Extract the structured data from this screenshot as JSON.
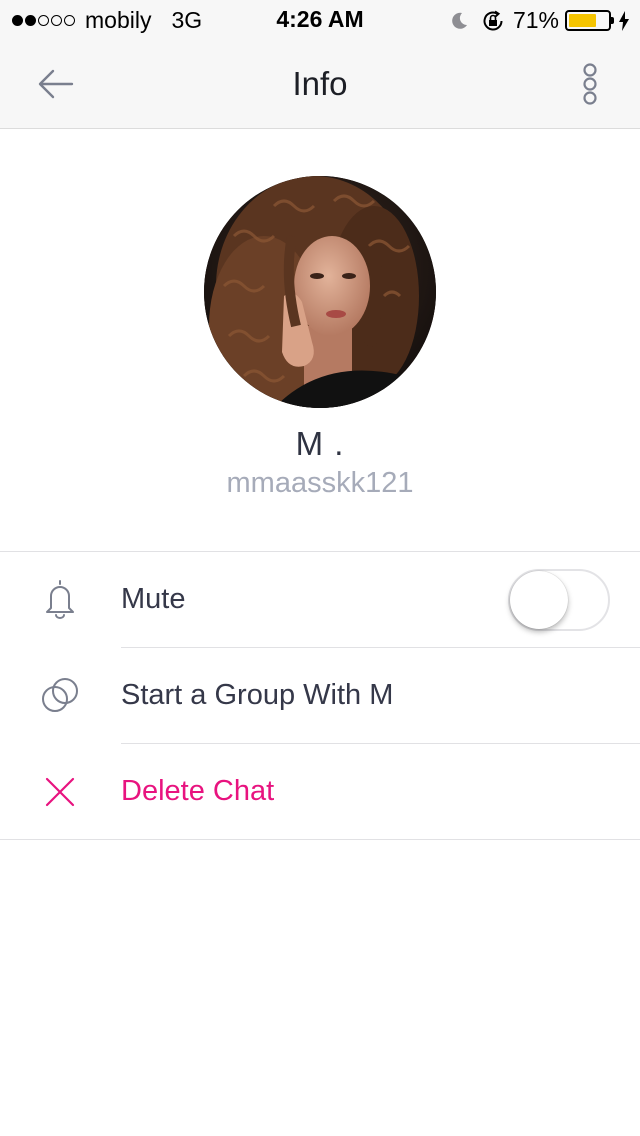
{
  "status_bar": {
    "carrier": "mobily",
    "network": "3G",
    "time": "4:26 AM",
    "battery": "71%",
    "battery_level": 0.71,
    "signal_bars": 2,
    "signal_total": 5,
    "battery_color": "#f5c400"
  },
  "nav": {
    "title": "Info",
    "back_icon": "arrow-left-icon",
    "more_icon": "vertical-dots-icon"
  },
  "profile": {
    "display_name": "M .",
    "username": "mmaasskk121"
  },
  "menu": {
    "mute": {
      "label": "Mute",
      "icon": "bell-icon",
      "toggle_on": false
    },
    "group": {
      "label": "Start a Group With M",
      "icon": "group-circles-icon"
    },
    "delete": {
      "label": "Delete Chat",
      "icon": "close-x-icon",
      "color": "#e8137f"
    }
  }
}
